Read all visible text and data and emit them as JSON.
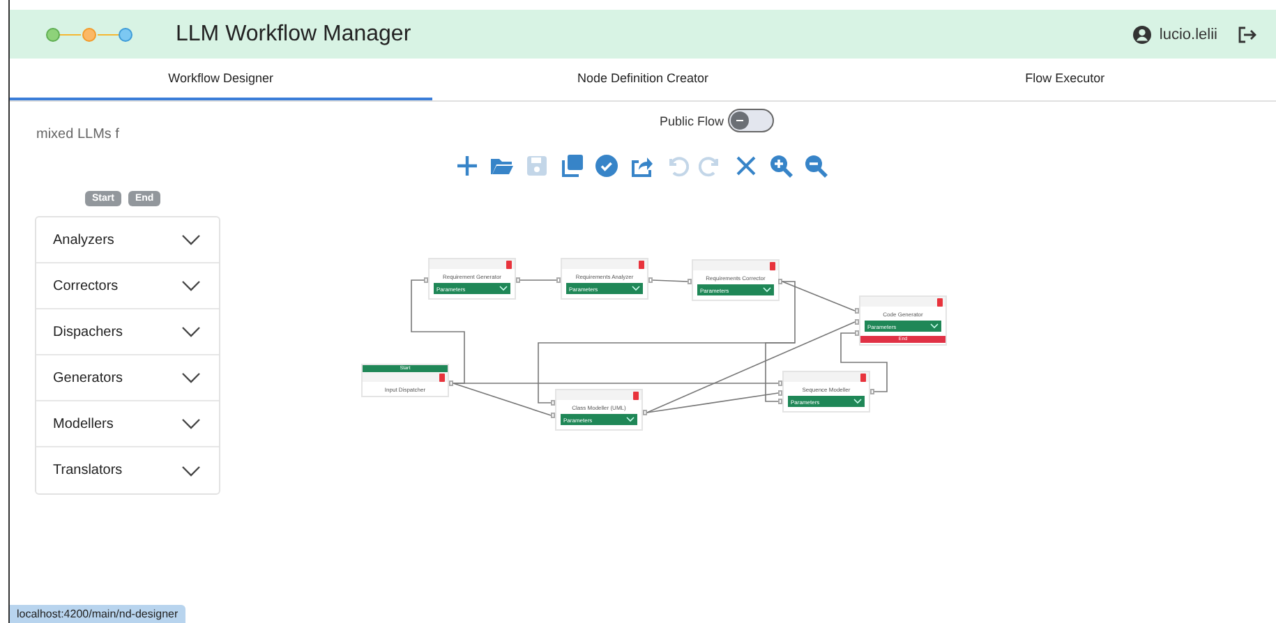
{
  "app": {
    "title": "LLM Workflow Manager",
    "user": "lucio.lelii"
  },
  "tabs": [
    {
      "label": "Workflow Designer",
      "selected": true
    },
    {
      "label": "Node Definition Creator",
      "selected": false
    },
    {
      "label": "Flow Executor",
      "selected": false
    }
  ],
  "flow_name": "mixed LLMs f",
  "public_flow": {
    "label": "Public Flow",
    "on": false
  },
  "toolbar": [
    {
      "kind": "add",
      "disabled": false
    },
    {
      "kind": "open",
      "disabled": false
    },
    {
      "kind": "save",
      "disabled": true
    },
    {
      "kind": "copy",
      "disabled": false
    },
    {
      "kind": "validate",
      "disabled": false
    },
    {
      "kind": "export",
      "disabled": false
    },
    {
      "kind": "undo",
      "disabled": true
    },
    {
      "kind": "redo",
      "disabled": true
    },
    {
      "kind": "clear",
      "disabled": false
    },
    {
      "kind": "zoom-in",
      "disabled": false
    },
    {
      "kind": "zoom-out",
      "disabled": false
    }
  ],
  "markers": [
    {
      "label": "Start",
      "disabled": true
    },
    {
      "label": "End",
      "disabled": true
    }
  ],
  "categories": [
    {
      "label": "Analyzers",
      "expanded": false
    },
    {
      "label": "Correctors",
      "expanded": false
    },
    {
      "label": "Dispachers",
      "expanded": false
    },
    {
      "label": "Generators",
      "expanded": false
    },
    {
      "label": "Modellers",
      "expanded": false
    },
    {
      "label": "Translators",
      "expanded": false
    }
  ],
  "nodes": [
    {
      "title": "Input Dispatcher",
      "badge": {
        "kind": "start",
        "label": "Start"
      }
    },
    {
      "title": "Requirement Generator",
      "parameters": "Parameters"
    },
    {
      "title": "Requirements Analyzer",
      "parameters": "Parameters"
    },
    {
      "title": "Requirements Corrector",
      "parameters": "Parameters"
    },
    {
      "title": "Class Modeller (UML)",
      "parameters": "Parameters"
    },
    {
      "title": "Sequence Modeller",
      "parameters": "Parameters"
    },
    {
      "title": "Code Generator",
      "parameters": "Parameters",
      "badge": {
        "kind": "end",
        "label": "End"
      }
    }
  ],
  "status_bar": "localhost:4200/main/nd-designer"
}
